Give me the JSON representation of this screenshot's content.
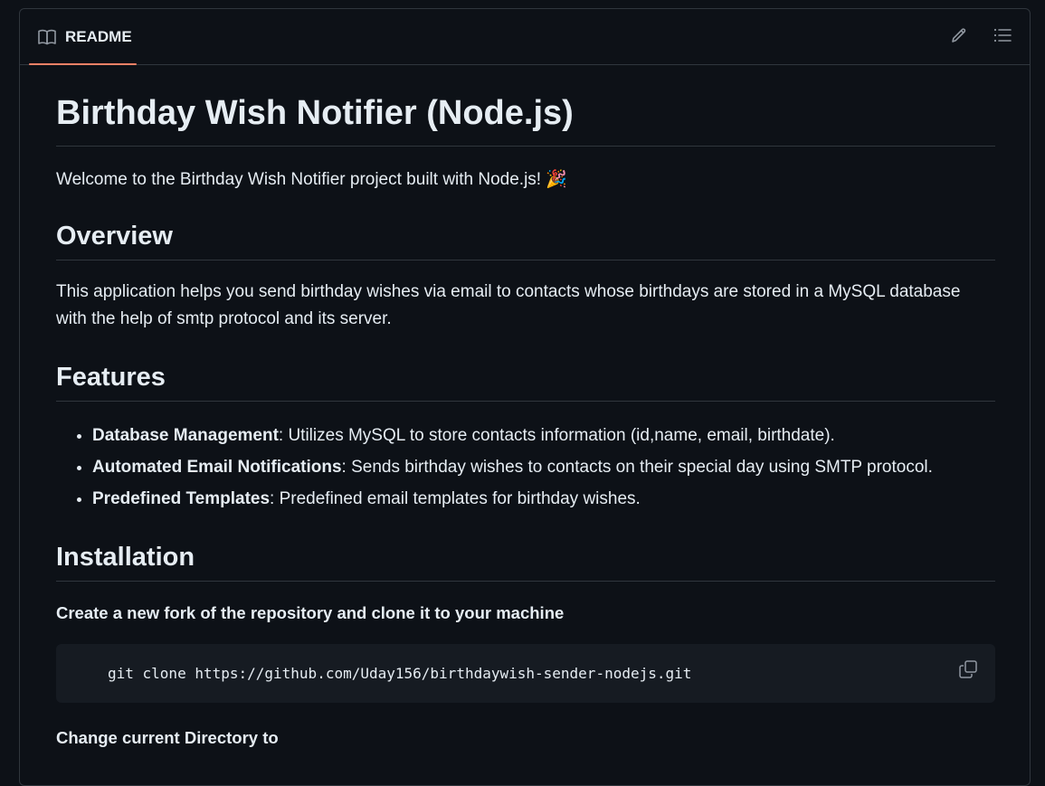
{
  "header": {
    "tab_label": "README",
    "icons": [
      "book-icon",
      "pencil-icon",
      "list-unordered-icon"
    ],
    "accent_color": "#f78166"
  },
  "content": {
    "title": "Birthday Wish Notifier (Node.js)",
    "intro": "Welcome to the Birthday Wish Notifier project built with Node.js! 🎉",
    "overview_heading": "Overview",
    "overview_text": "This application helps you send birthday wishes via email to contacts whose birthdays are stored in a MySQL database with the help of smtp protocol and its server.",
    "features_heading": "Features",
    "features": [
      {
        "name": "Database Management",
        "desc": ": Utilizes MySQL to store contacts information (id,name, email, birthdate)."
      },
      {
        "name": "Automated Email Notifications",
        "desc": ": Sends birthday wishes to contacts on their special day using SMTP protocol."
      },
      {
        "name": "Predefined Templates",
        "desc": ": Predefined email templates for birthday wishes."
      }
    ],
    "installation_heading": "Installation",
    "step1": "Create a new fork of the repository and clone it to your machine",
    "code1": "git clone https://github.com/Uday156/birthdaywish-sender-nodejs.git",
    "step2": "Change current Directory to"
  }
}
